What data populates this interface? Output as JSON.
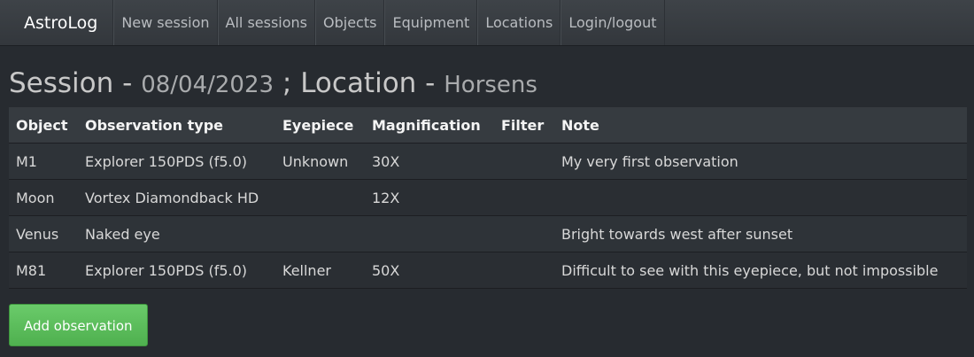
{
  "nav": {
    "brand": "AstroLog",
    "items": [
      "New session",
      "All sessions",
      "Objects",
      "Equipment",
      "Locations",
      "Login/logout"
    ]
  },
  "header": {
    "session_label": "Session",
    "session_sep": " - ",
    "date": "08/04/2023",
    "divider": " ; ",
    "location_label": "Location",
    "location_sep": " - ",
    "location": "Horsens"
  },
  "table": {
    "columns": [
      "Object",
      "Observation type",
      "Eyepiece",
      "Magnification",
      "Filter",
      "Note"
    ],
    "rows": [
      [
        "M1",
        "Explorer 150PDS (f5.0)",
        "Unknown",
        "30X",
        "",
        "My very first observation"
      ],
      [
        "Moon",
        "Vortex Diamondback HD",
        "",
        "12X",
        "",
        ""
      ],
      [
        "Venus",
        "Naked eye",
        "",
        "",
        "",
        "Bright towards west after sunset"
      ],
      [
        "M81",
        "Explorer 150PDS (f5.0)",
        "Kellner",
        "50X",
        "",
        "Difficult to see with this eyepiece, but not impossible"
      ]
    ]
  },
  "actions": {
    "add_observation": "Add observation"
  },
  "colors": {
    "background": "#272b30",
    "navbar": "#3a3f44",
    "button": "#62c462"
  }
}
